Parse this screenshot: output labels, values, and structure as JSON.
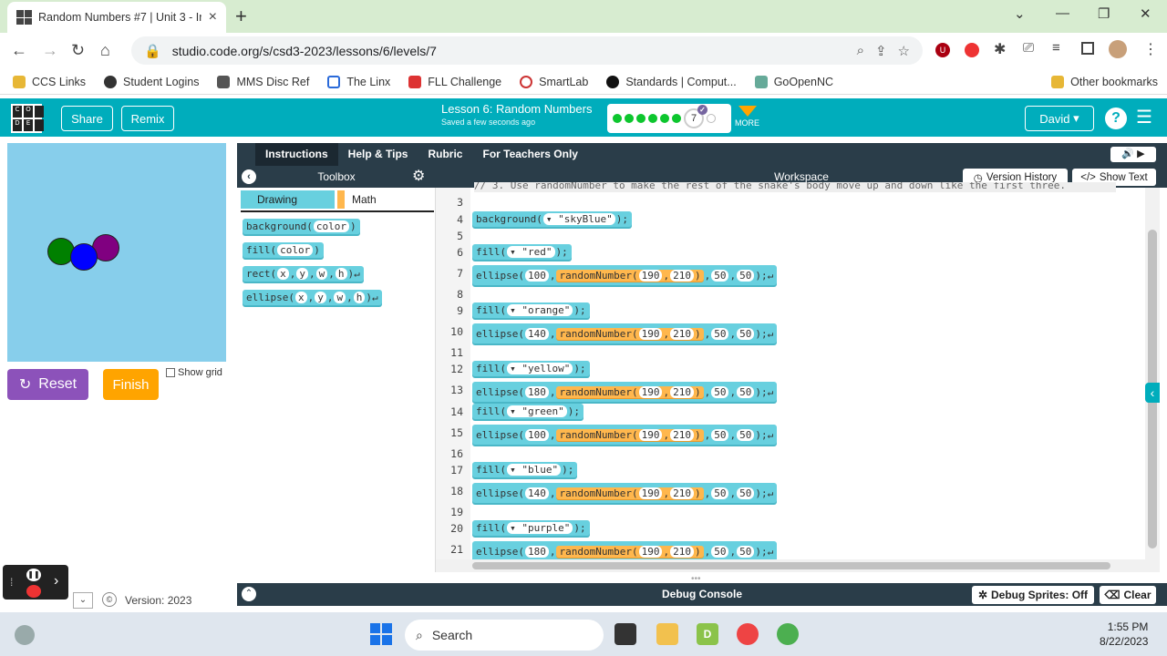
{
  "browser": {
    "tab_title": "Random Numbers #7 | Unit 3 - Ir",
    "url": "studio.code.org/s/csd3-2023/lessons/6/levels/7",
    "bookmarks": [
      "CCS Links",
      "Student Logins",
      "MMS Disc Ref",
      "The Linx",
      "FLL Challenge",
      "SmartLab",
      "Standards | Comput...",
      "GoOpenNC"
    ],
    "other_bookmarks": "Other bookmarks"
  },
  "header": {
    "share": "Share",
    "remix": "Remix",
    "lesson": "Lesson 6: Random Numbers",
    "saved": "Saved a few seconds ago",
    "level": "7",
    "more": "MORE",
    "user": "David",
    "help": "?"
  },
  "viz": {
    "reset": "Reset",
    "finish": "Finish",
    "show_grid": "Show grid"
  },
  "tabs": [
    "Instructions",
    "Help & Tips",
    "Rubric",
    "For Teachers Only"
  ],
  "toolbox": {
    "title": "Toolbox",
    "categories": [
      "Drawing",
      "Math"
    ],
    "blocks": [
      {
        "name": "background",
        "args": [
          "color"
        ]
      },
      {
        "name": "fill",
        "args": [
          "color"
        ]
      },
      {
        "name": "rect",
        "args": [
          "x",
          "y",
          "w",
          "h"
        ]
      },
      {
        "name": "ellipse",
        "args": [
          "x",
          "y",
          "w",
          "h"
        ]
      }
    ]
  },
  "workspace": {
    "title": "Workspace",
    "version_history": "Version History",
    "show_text": "Show Text",
    "comment": "// 3. Use randomNumber to make the rest of the snake's body move up and down like the first three.",
    "lines": [
      {
        "n": "3",
        "code": ""
      },
      {
        "n": "4",
        "kind": "bg",
        "color": "\"skyBlue\""
      },
      {
        "n": "5",
        "code": ""
      },
      {
        "n": "6",
        "kind": "fill",
        "color": "\"red\""
      },
      {
        "n": "7",
        "kind": "ell",
        "x": "100",
        "r1": "190",
        "r2": "210",
        "w": "50",
        "h": "50"
      },
      {
        "n": "8",
        "code": ""
      },
      {
        "n": "9",
        "kind": "fill",
        "color": "\"orange\""
      },
      {
        "n": "10",
        "kind": "ell",
        "x": "140",
        "r1": "190",
        "r2": "210",
        "w": "50",
        "h": "50"
      },
      {
        "n": "11",
        "code": ""
      },
      {
        "n": "12",
        "kind": "fill",
        "color": "\"yellow\""
      },
      {
        "n": "13",
        "kind": "ell",
        "x": "180",
        "r1": "190",
        "r2": "210",
        "w": "50",
        "h": "50"
      },
      {
        "n": "14",
        "kind": "fill",
        "color": "\"green\""
      },
      {
        "n": "15",
        "kind": "ell",
        "x": "100",
        "r1": "190",
        "r2": "210",
        "w": "50",
        "h": "50"
      },
      {
        "n": "16",
        "code": ""
      },
      {
        "n": "17",
        "kind": "fill",
        "color": "\"blue\""
      },
      {
        "n": "18",
        "kind": "ell",
        "x": "140",
        "r1": "190",
        "r2": "210",
        "w": "50",
        "h": "50"
      },
      {
        "n": "19",
        "code": ""
      },
      {
        "n": "20",
        "kind": "fill",
        "color": "\"purple\""
      },
      {
        "n": "21",
        "kind": "ell",
        "x": "180",
        "r1": "190",
        "r2": "210",
        "w": "50",
        "h": "50"
      }
    ]
  },
  "debug": {
    "title": "Debug Console",
    "sprites": "Debug Sprites: Off",
    "clear": "Clear"
  },
  "version": "Version: 2023",
  "taskbar": {
    "search": "Search",
    "time": "1:55 PM",
    "date": "8/22/2023"
  },
  "colors": {
    "teal": "#00adbc",
    "dark": "#2a3d49",
    "block": "#68d0df",
    "orange": "#ffa400",
    "purple": "#8c52ba"
  }
}
